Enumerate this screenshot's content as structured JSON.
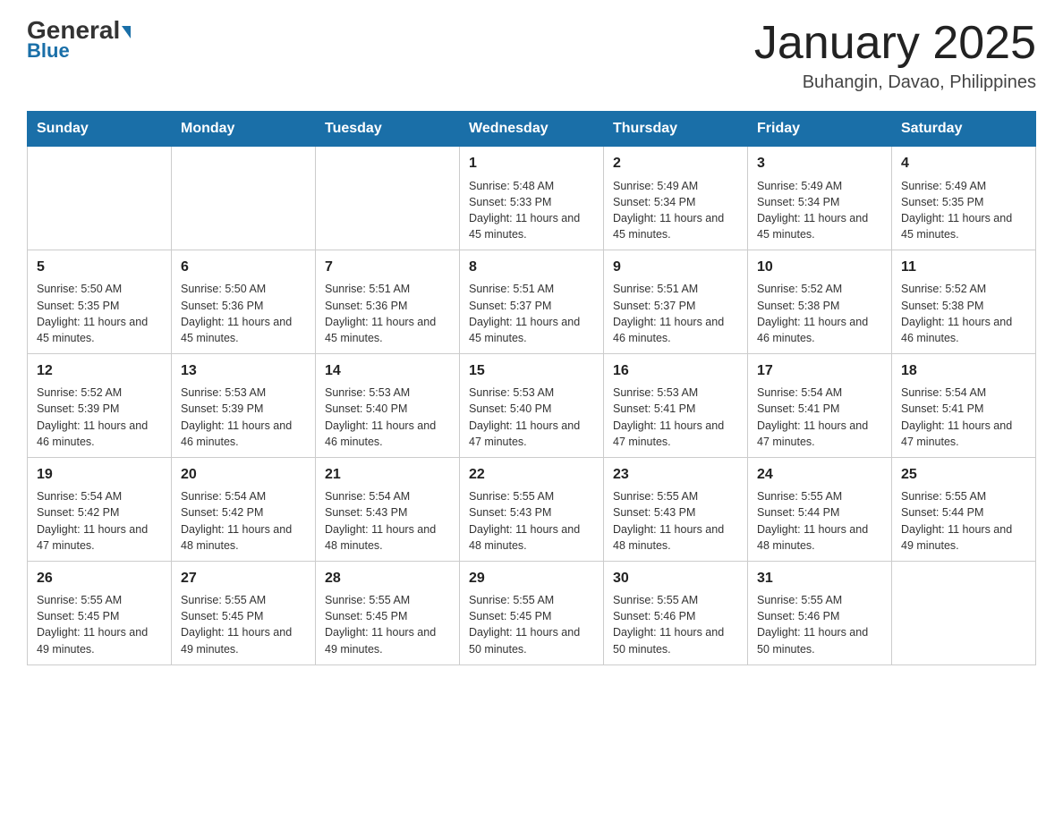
{
  "logo": {
    "general": "General",
    "blue": "Blue"
  },
  "header": {
    "month": "January 2025",
    "location": "Buhangin, Davao, Philippines"
  },
  "days_of_week": [
    "Sunday",
    "Monday",
    "Tuesday",
    "Wednesday",
    "Thursday",
    "Friday",
    "Saturday"
  ],
  "weeks": [
    [
      {
        "day": "",
        "info": ""
      },
      {
        "day": "",
        "info": ""
      },
      {
        "day": "",
        "info": ""
      },
      {
        "day": "1",
        "info": "Sunrise: 5:48 AM\nSunset: 5:33 PM\nDaylight: 11 hours and 45 minutes."
      },
      {
        "day": "2",
        "info": "Sunrise: 5:49 AM\nSunset: 5:34 PM\nDaylight: 11 hours and 45 minutes."
      },
      {
        "day": "3",
        "info": "Sunrise: 5:49 AM\nSunset: 5:34 PM\nDaylight: 11 hours and 45 minutes."
      },
      {
        "day": "4",
        "info": "Sunrise: 5:49 AM\nSunset: 5:35 PM\nDaylight: 11 hours and 45 minutes."
      }
    ],
    [
      {
        "day": "5",
        "info": "Sunrise: 5:50 AM\nSunset: 5:35 PM\nDaylight: 11 hours and 45 minutes."
      },
      {
        "day": "6",
        "info": "Sunrise: 5:50 AM\nSunset: 5:36 PM\nDaylight: 11 hours and 45 minutes."
      },
      {
        "day": "7",
        "info": "Sunrise: 5:51 AM\nSunset: 5:36 PM\nDaylight: 11 hours and 45 minutes."
      },
      {
        "day": "8",
        "info": "Sunrise: 5:51 AM\nSunset: 5:37 PM\nDaylight: 11 hours and 45 minutes."
      },
      {
        "day": "9",
        "info": "Sunrise: 5:51 AM\nSunset: 5:37 PM\nDaylight: 11 hours and 46 minutes."
      },
      {
        "day": "10",
        "info": "Sunrise: 5:52 AM\nSunset: 5:38 PM\nDaylight: 11 hours and 46 minutes."
      },
      {
        "day": "11",
        "info": "Sunrise: 5:52 AM\nSunset: 5:38 PM\nDaylight: 11 hours and 46 minutes."
      }
    ],
    [
      {
        "day": "12",
        "info": "Sunrise: 5:52 AM\nSunset: 5:39 PM\nDaylight: 11 hours and 46 minutes."
      },
      {
        "day": "13",
        "info": "Sunrise: 5:53 AM\nSunset: 5:39 PM\nDaylight: 11 hours and 46 minutes."
      },
      {
        "day": "14",
        "info": "Sunrise: 5:53 AM\nSunset: 5:40 PM\nDaylight: 11 hours and 46 minutes."
      },
      {
        "day": "15",
        "info": "Sunrise: 5:53 AM\nSunset: 5:40 PM\nDaylight: 11 hours and 47 minutes."
      },
      {
        "day": "16",
        "info": "Sunrise: 5:53 AM\nSunset: 5:41 PM\nDaylight: 11 hours and 47 minutes."
      },
      {
        "day": "17",
        "info": "Sunrise: 5:54 AM\nSunset: 5:41 PM\nDaylight: 11 hours and 47 minutes."
      },
      {
        "day": "18",
        "info": "Sunrise: 5:54 AM\nSunset: 5:41 PM\nDaylight: 11 hours and 47 minutes."
      }
    ],
    [
      {
        "day": "19",
        "info": "Sunrise: 5:54 AM\nSunset: 5:42 PM\nDaylight: 11 hours and 47 minutes."
      },
      {
        "day": "20",
        "info": "Sunrise: 5:54 AM\nSunset: 5:42 PM\nDaylight: 11 hours and 48 minutes."
      },
      {
        "day": "21",
        "info": "Sunrise: 5:54 AM\nSunset: 5:43 PM\nDaylight: 11 hours and 48 minutes."
      },
      {
        "day": "22",
        "info": "Sunrise: 5:55 AM\nSunset: 5:43 PM\nDaylight: 11 hours and 48 minutes."
      },
      {
        "day": "23",
        "info": "Sunrise: 5:55 AM\nSunset: 5:43 PM\nDaylight: 11 hours and 48 minutes."
      },
      {
        "day": "24",
        "info": "Sunrise: 5:55 AM\nSunset: 5:44 PM\nDaylight: 11 hours and 48 minutes."
      },
      {
        "day": "25",
        "info": "Sunrise: 5:55 AM\nSunset: 5:44 PM\nDaylight: 11 hours and 49 minutes."
      }
    ],
    [
      {
        "day": "26",
        "info": "Sunrise: 5:55 AM\nSunset: 5:45 PM\nDaylight: 11 hours and 49 minutes."
      },
      {
        "day": "27",
        "info": "Sunrise: 5:55 AM\nSunset: 5:45 PM\nDaylight: 11 hours and 49 minutes."
      },
      {
        "day": "28",
        "info": "Sunrise: 5:55 AM\nSunset: 5:45 PM\nDaylight: 11 hours and 49 minutes."
      },
      {
        "day": "29",
        "info": "Sunrise: 5:55 AM\nSunset: 5:45 PM\nDaylight: 11 hours and 50 minutes."
      },
      {
        "day": "30",
        "info": "Sunrise: 5:55 AM\nSunset: 5:46 PM\nDaylight: 11 hours and 50 minutes."
      },
      {
        "day": "31",
        "info": "Sunrise: 5:55 AM\nSunset: 5:46 PM\nDaylight: 11 hours and 50 minutes."
      },
      {
        "day": "",
        "info": ""
      }
    ]
  ]
}
